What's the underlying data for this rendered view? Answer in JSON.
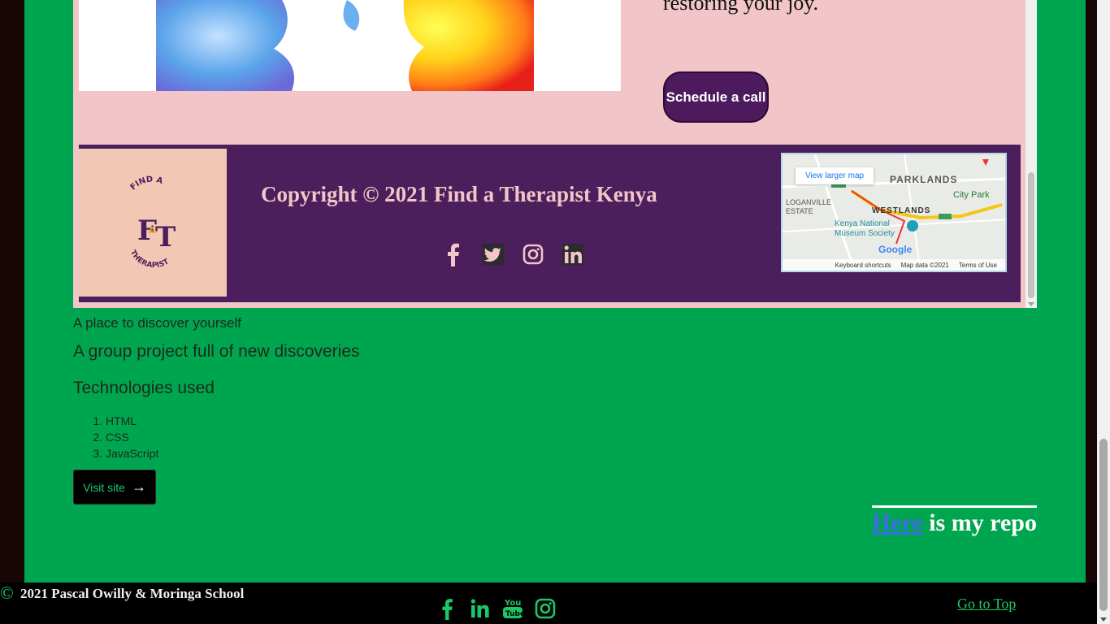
{
  "preview": {
    "tagline": "restoring your joy.",
    "schedule_label": "Schedule a call",
    "copyright": "Copyright © 2021 Find a Therapist Kenya",
    "logo_text": "FIND A THERAPIST",
    "map": {
      "view_larger": "View larger map",
      "brand": "Google",
      "keyboard": "Keyboard shortcuts",
      "map_data": "Map data ©2021",
      "terms": "Terms of Use",
      "labels": [
        "PARKLANDS",
        "City Park",
        "WESTLANDS",
        "Kenya National Museum Society",
        "LOGANVILLE ESTATE"
      ]
    },
    "social_icons": [
      "facebook-icon",
      "twitter-icon",
      "instagram-icon",
      "linkedin-icon"
    ]
  },
  "project": {
    "tagline": "A place to discover yourself",
    "subtitle": "A group project full of new discoveries",
    "tech_heading": "Technologies used",
    "technologies": [
      "HTML",
      "CSS",
      "JavaScript"
    ],
    "visit_label": "Visit site",
    "visit_arrow": "→",
    "repo_link": "Here",
    "repo_rest": " is my repo"
  },
  "footer": {
    "copyright_symbol": "©",
    "copyright_text": "2021 Pascal Owilly & Moringa School",
    "go_top": "Go to Top",
    "social_icons": [
      "facebook-icon",
      "linkedin-icon",
      "youtube-icon",
      "instagram-icon"
    ]
  },
  "colors": {
    "page_green": "#00a64f",
    "accent_green": "#1bc76a",
    "preview_pink": "#f2c5c8",
    "preview_purple": "#4b1f5c",
    "link_blue": "#3b6ee8"
  }
}
